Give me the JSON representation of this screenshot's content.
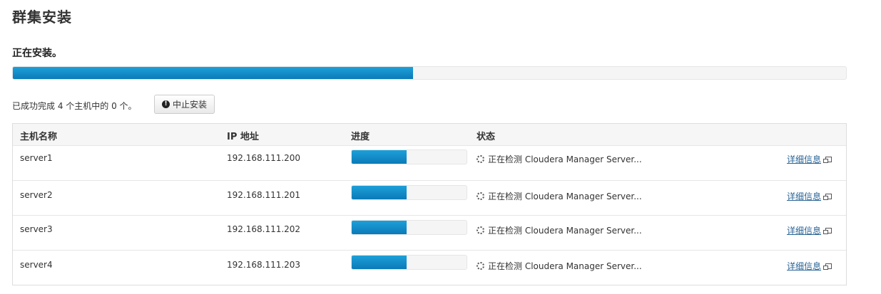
{
  "page": {
    "title": "群集安装",
    "section_title": "正在安装。"
  },
  "overall_progress": {
    "fraction": 0.48,
    "color": "#0a7ab8"
  },
  "summary": {
    "text": "已成功完成 4 个主机中的 0 个。"
  },
  "abort_button": {
    "label": "中止安装",
    "icon": "exclamation-circle-icon"
  },
  "table": {
    "headers": [
      "主机名称",
      "IP 地址",
      "进度",
      "状态"
    ],
    "rows": [
      {
        "host": "server1",
        "ip": "192.168.111.200",
        "progress": 0.48,
        "status": "正在检测 Cloudera Manager Server...",
        "details": "详细信息"
      },
      {
        "host": "server2",
        "ip": "192.168.111.201",
        "progress": 0.48,
        "status": "正在检测 Cloudera Manager Server...",
        "details": "详细信息"
      },
      {
        "host": "server3",
        "ip": "192.168.111.202",
        "progress": 0.48,
        "status": "正在检测 Cloudera Manager Server...",
        "details": "详细信息"
      },
      {
        "host": "server4",
        "ip": "192.168.111.203",
        "progress": 0.48,
        "status": "正在检测 Cloudera Manager Server...",
        "details": "详细信息"
      }
    ]
  }
}
